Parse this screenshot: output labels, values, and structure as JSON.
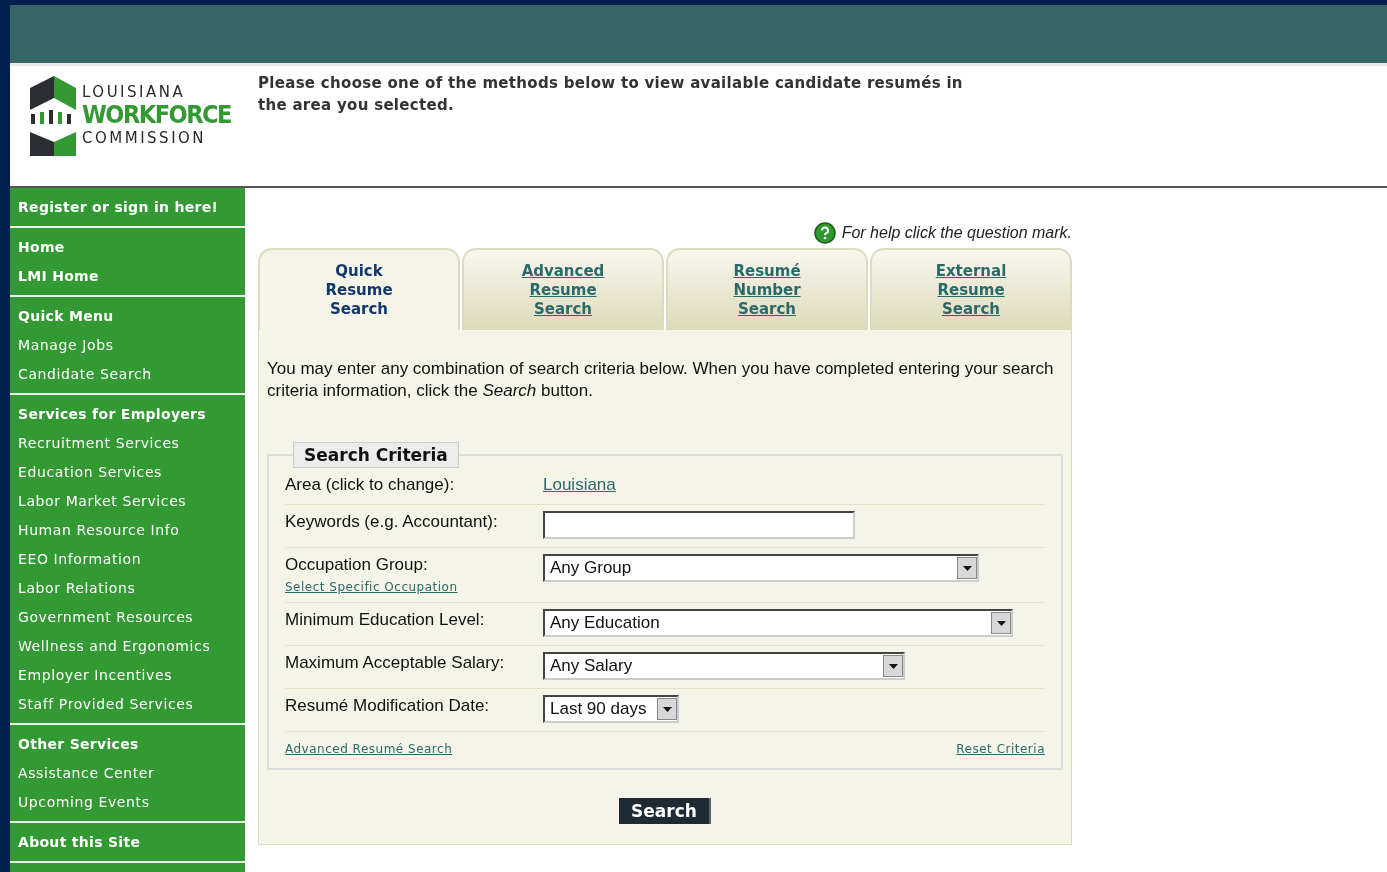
{
  "logo": {
    "lines": [
      "LOUISIANA",
      "WORKFORCE",
      "COMMISSION"
    ]
  },
  "intro": "Please choose one of the methods below to view available candidate resumés in the area you selected.",
  "sidebar": {
    "sections": [
      {
        "items": [
          {
            "label": "Register or sign in here!",
            "kind": "heading"
          }
        ]
      },
      {
        "items": [
          {
            "label": "Home",
            "kind": "heading"
          },
          {
            "label": "LMI Home",
            "kind": "heading"
          }
        ]
      },
      {
        "items": [
          {
            "label": "Quick Menu",
            "kind": "heading"
          },
          {
            "label": "Manage Jobs",
            "kind": "link"
          },
          {
            "label": "Candidate Search",
            "kind": "link"
          }
        ]
      },
      {
        "items": [
          {
            "label": "Services for Employers",
            "kind": "heading"
          },
          {
            "label": "Recruitment Services",
            "kind": "link"
          },
          {
            "label": "Education Services",
            "kind": "link"
          },
          {
            "label": "Labor Market Services",
            "kind": "link"
          },
          {
            "label": "Human Resource Info",
            "kind": "link"
          },
          {
            "label": "EEO Information",
            "kind": "link"
          },
          {
            "label": "Labor Relations",
            "kind": "link"
          },
          {
            "label": "Government Resources",
            "kind": "link"
          },
          {
            "label": "Wellness and Ergonomics",
            "kind": "link"
          },
          {
            "label": "Employer Incentives",
            "kind": "link"
          },
          {
            "label": "Staff Provided Services",
            "kind": "link"
          }
        ]
      },
      {
        "items": [
          {
            "label": "Other Services",
            "kind": "heading"
          },
          {
            "label": "Assistance Center",
            "kind": "link"
          },
          {
            "label": "Upcoming Events",
            "kind": "link"
          }
        ]
      },
      {
        "items": [
          {
            "label": "About this Site",
            "kind": "heading"
          }
        ]
      }
    ]
  },
  "help": "For help click the question mark.",
  "tabs": [
    {
      "label": "Quick Resume Search",
      "selected": true
    },
    {
      "label": "Advanced Resume Search",
      "selected": false
    },
    {
      "label": "Resumé Number Search",
      "selected": false
    },
    {
      "label": "External Resume Search",
      "selected": false
    }
  ],
  "instructions": "You may enter any combination of search criteria below. When you have completed entering your search criteria information, click the *Search* button.",
  "criteria": {
    "legend": "Search Criteria",
    "rows": [
      {
        "kind": "link",
        "label": "Area (click to change):",
        "value": "Louisiana"
      },
      {
        "kind": "text",
        "label": "Keywords (e.g. Accountant):",
        "value": ""
      },
      {
        "kind": "select",
        "label": "Occupation Group:",
        "value": "Any Group",
        "sublink": "Select Specific Occupation"
      },
      {
        "kind": "select",
        "label": "Minimum Education Level:",
        "value": "Any Education"
      },
      {
        "kind": "select",
        "label": "Maximum Acceptable Salary:",
        "value": "Any Salary"
      },
      {
        "kind": "select",
        "label": "Resumé Modification Date:",
        "value": "Last 90 days"
      }
    ],
    "footer_links": [
      "Advanced Resumé Search",
      "Reset Criteria"
    ]
  },
  "search_button": "Search"
}
